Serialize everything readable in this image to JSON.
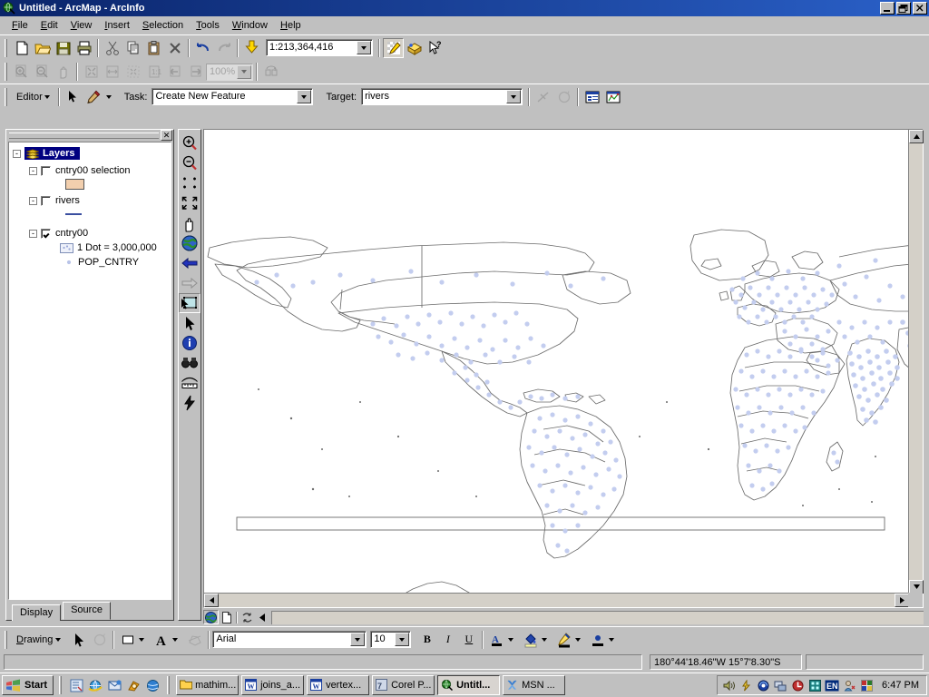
{
  "window": {
    "title": "Untitled - ArcMap - ArcInfo",
    "app_icon": "arcmap-globe-icon",
    "buttons": {
      "minimize": "_",
      "restore": "❐",
      "close": "✕"
    }
  },
  "menubar": {
    "items": [
      {
        "label": "File",
        "accel": "F"
      },
      {
        "label": "Edit",
        "accel": "E"
      },
      {
        "label": "View",
        "accel": "V"
      },
      {
        "label": "Insert",
        "accel": "I"
      },
      {
        "label": "Selection",
        "accel": "S"
      },
      {
        "label": "Tools",
        "accel": "T"
      },
      {
        "label": "Window",
        "accel": "W"
      },
      {
        "label": "Help",
        "accel": "H"
      }
    ]
  },
  "standard_toolbar": {
    "buttons": [
      {
        "name": "new-document-button",
        "icon": "new-page-icon"
      },
      {
        "name": "open-button",
        "icon": "open-folder-icon"
      },
      {
        "name": "save-button",
        "icon": "floppy-disk-icon"
      },
      {
        "name": "print-button",
        "icon": "printer-icon"
      },
      {
        "name": "cut-button",
        "icon": "scissors-icon"
      },
      {
        "name": "copy-button",
        "icon": "copy-icon"
      },
      {
        "name": "paste-button",
        "icon": "clipboard-paste-icon"
      },
      {
        "name": "delete-button",
        "icon": "delete-x-icon"
      },
      {
        "name": "undo-button",
        "icon": "undo-arrow-icon"
      },
      {
        "name": "redo-button",
        "icon": "redo-arrow-icon"
      },
      {
        "name": "add-data-button",
        "icon": "add-data-plus-icon"
      }
    ],
    "scale_label": "1:213,364,416",
    "right_buttons": [
      {
        "name": "editor-toolbar-button",
        "icon": "editor-pencil-icon"
      },
      {
        "name": "arctoolbox-button",
        "icon": "arctoolbox-icon"
      },
      {
        "name": "whats-this-help-button",
        "icon": "help-pointer-icon"
      }
    ]
  },
  "layout_toolbar": {
    "zoom_value": "100%",
    "buttons": [
      {
        "name": "zoom-in-page-button",
        "icon": "page-zoom-in-icon"
      },
      {
        "name": "zoom-out-page-button",
        "icon": "page-zoom-out-icon"
      },
      {
        "name": "pan-page-button",
        "icon": "hand-pan-icon"
      },
      {
        "name": "zoom-whole-page-button",
        "icon": "whole-page-icon"
      },
      {
        "name": "zoom-page-width-button",
        "icon": "page-width-icon"
      },
      {
        "name": "zoom-to-selection-button",
        "icon": "zoom-selection-icon"
      },
      {
        "name": "zoom-100-button",
        "icon": "one-to-one-icon"
      },
      {
        "name": "go-back-extent-button",
        "icon": "back-extent-icon"
      },
      {
        "name": "go-forward-extent-button",
        "icon": "forward-extent-icon"
      },
      {
        "name": "toggle-draft-mode-button",
        "icon": "draft-mode-icon"
      }
    ]
  },
  "editor_toolbar": {
    "editor_menu_label": "Editor",
    "task_label": "Task:",
    "task_value": "Create New Feature",
    "target_label": "Target:",
    "target_value": "rivers",
    "buttons": [
      {
        "name": "edit-tool-button",
        "icon": "black-arrow-icon"
      },
      {
        "name": "sketch-tool-button",
        "icon": "pencil-sketch-icon"
      },
      {
        "name": "split-tool-button",
        "icon": "split-line-icon"
      },
      {
        "name": "rotate-tool-button",
        "icon": "rotate-icon"
      },
      {
        "name": "attributes-button",
        "icon": "attributes-table-icon"
      },
      {
        "name": "sketch-properties-button",
        "icon": "sketch-properties-icon"
      }
    ]
  },
  "toc": {
    "close_button": "✕",
    "root": {
      "label": "Layers",
      "expander": "-",
      "icon": "layers-stack-icon"
    },
    "layers": [
      {
        "label": "cntry00 selection",
        "expander": "-",
        "checked": false,
        "symbol": {
          "type": "polygon-swatch",
          "fill": "#f2cfae",
          "stroke": "#000000"
        }
      },
      {
        "label": "rivers",
        "expander": "-",
        "checked": false,
        "symbol": {
          "type": "line-swatch",
          "stroke": "#3a4fa0"
        }
      },
      {
        "label": "cntry00",
        "expander": "-",
        "checked": true,
        "legend": [
          {
            "label": "1 Dot = 3,000,000",
            "symbol": "dot-density-swatch"
          },
          {
            "label": "POP_CNTRY",
            "symbol": "small-dot-icon"
          }
        ]
      }
    ],
    "tabs": [
      {
        "label": "Display",
        "active": false
      },
      {
        "label": "Source",
        "active": true
      }
    ]
  },
  "tools_palette": {
    "items": [
      {
        "name": "zoom-in-tool",
        "icon": "magnifier-plus-icon",
        "pressed": false
      },
      {
        "name": "zoom-out-tool",
        "icon": "magnifier-minus-icon",
        "pressed": false
      },
      {
        "name": "fixed-zoom-in-tool",
        "icon": "fixed-zoom-in-icon",
        "pressed": false
      },
      {
        "name": "fixed-zoom-out-tool",
        "icon": "fixed-zoom-out-icon",
        "pressed": false
      },
      {
        "name": "pan-tool",
        "icon": "hand-pan-icon",
        "pressed": false
      },
      {
        "name": "full-extent-tool",
        "icon": "globe-icon",
        "pressed": false
      },
      {
        "name": "go-back-extent-tool",
        "icon": "blue-left-arrow-icon",
        "pressed": false
      },
      {
        "name": "go-forward-extent-tool",
        "icon": "gray-right-arrow-icon",
        "pressed": false
      },
      {
        "name": "select-features-tool",
        "icon": "select-features-icon",
        "pressed": true
      },
      {
        "name": "select-elements-tool",
        "icon": "black-arrow-icon",
        "pressed": false
      },
      {
        "name": "identify-tool",
        "icon": "identify-info-icon",
        "pressed": false
      },
      {
        "name": "find-tool",
        "icon": "binoculars-icon",
        "pressed": false
      },
      {
        "name": "measure-tool",
        "icon": "measure-ruler-icon",
        "pressed": false
      },
      {
        "name": "hyperlink-tool",
        "icon": "lightning-bolt-icon",
        "pressed": false
      }
    ]
  },
  "map": {
    "background": "#ffffff",
    "country_outline_color": "#6b6b6b",
    "dot_color": "#c3cdef",
    "fill_color": "#ffffff"
  },
  "view_bar": {
    "buttons": [
      {
        "name": "data-view-button",
        "icon": "globe-icon",
        "pressed": true
      },
      {
        "name": "layout-view-button",
        "icon": "page-icon",
        "pressed": false
      },
      {
        "name": "refresh-view-button",
        "icon": "refresh-icon",
        "pressed": false
      },
      {
        "name": "pause-drawing-button",
        "icon": "pause-left-arrow-icon",
        "pressed": false
      }
    ]
  },
  "drawing_toolbar": {
    "menu_label": "Drawing",
    "font_name": "Arial",
    "font_size": "10",
    "bold_label": "B",
    "italic_label": "I",
    "underline_label": "U",
    "buttons": [
      {
        "name": "select-elements-button",
        "icon": "black-arrow-icon"
      },
      {
        "name": "rotate-element-button",
        "icon": "rotate-icon"
      },
      {
        "name": "new-rectangle-button",
        "icon": "rectangle-icon"
      },
      {
        "name": "new-text-button",
        "icon": "text-a-icon"
      },
      {
        "name": "edit-vertices-button",
        "icon": "edit-vertices-icon"
      },
      {
        "name": "font-color-button",
        "icon": "font-color-icon"
      },
      {
        "name": "fill-color-button",
        "icon": "fill-color-icon"
      },
      {
        "name": "line-color-button",
        "icon": "line-color-icon"
      },
      {
        "name": "marker-color-button",
        "icon": "marker-color-icon"
      }
    ]
  },
  "status_bar": {
    "coordinates": "180°44'18.46\"W  15°7'8.30\"S",
    "message": ""
  },
  "taskbar": {
    "start_label": "Start",
    "quick_launch": [
      {
        "name": "show-desktop-icon",
        "icon": "desktop-icon"
      },
      {
        "name": "internet-explorer-icon",
        "icon": "ie-icon"
      },
      {
        "name": "outlook-express-icon",
        "icon": "mail-icon"
      },
      {
        "name": "media-player-icon",
        "icon": "media-icon"
      },
      {
        "name": "msn-icon",
        "icon": "msn-butterfly-icon"
      }
    ],
    "tasks": [
      {
        "label": "mathim...",
        "icon": "folder-icon",
        "active": false
      },
      {
        "label": "joins_a...",
        "icon": "word-doc-icon",
        "active": false
      },
      {
        "label": "vertex...",
        "icon": "word-doc-icon",
        "active": false
      },
      {
        "label": "Corel P...",
        "icon": "corel-icon",
        "active": false
      },
      {
        "label": "Untitl...",
        "icon": "arcmap-globe-icon",
        "active": true
      },
      {
        "label": "MSN ...",
        "icon": "msn-butterfly-icon",
        "active": false
      }
    ],
    "tray": [
      {
        "name": "volume-tray-icon",
        "icon": "speaker-icon"
      },
      {
        "name": "power-tray-icon",
        "icon": "lightning-icon"
      },
      {
        "name": "wireless-tray-icon",
        "icon": "wireless-icon"
      },
      {
        "name": "network-tray-icon",
        "icon": "network-icon"
      },
      {
        "name": "antivirus-tray-icon",
        "icon": "shield-icon"
      },
      {
        "name": "display-tray-icon",
        "icon": "display-icon"
      },
      {
        "name": "language-tray-icon",
        "icon": "lang-en-icon",
        "label": "EN"
      },
      {
        "name": "user-tray-icon",
        "icon": "user-icon"
      },
      {
        "name": "puzzle-tray-icon",
        "icon": "puzzle-icon"
      }
    ],
    "clock": "6:47 PM"
  }
}
